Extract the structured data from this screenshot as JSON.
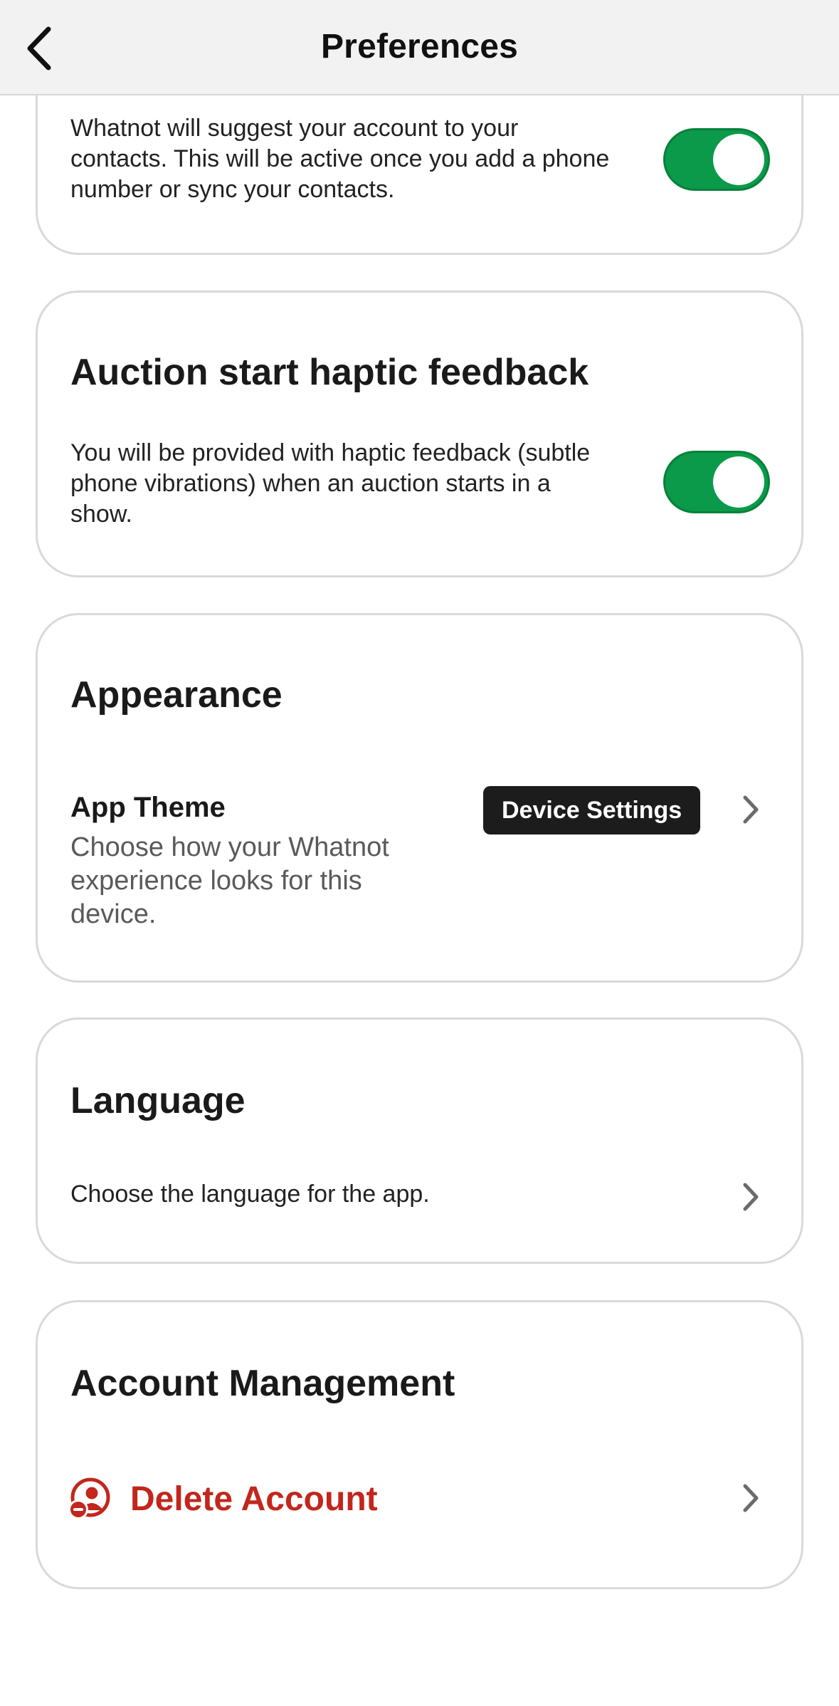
{
  "header": {
    "title": "Preferences"
  },
  "suggest_card": {
    "description": "Whatnot will suggest your account to your contacts. This will be active once you add a phone number or sync your contacts.",
    "toggle_on": true
  },
  "haptic_card": {
    "title": "Auction start haptic feedback",
    "description": "You will be provided with haptic feedback (subtle phone vibrations) when an auction starts in a show.",
    "toggle_on": true
  },
  "appearance_card": {
    "title": "Appearance",
    "app_theme": {
      "label": "App Theme",
      "description": "Choose how your Whatnot experience looks for this device.",
      "value": "Device Settings"
    }
  },
  "language_card": {
    "title": "Language",
    "description": "Choose the language for the app."
  },
  "account_card": {
    "title": "Account Management",
    "delete_label": "Delete Account"
  },
  "colors": {
    "toggle_on": "#0a9a49",
    "danger": "#c2261c",
    "badge_bg": "#1c1c1c"
  },
  "icons": {
    "back": "chevron-left-icon",
    "row": "chevron-right-icon",
    "delete": "user-remove-icon"
  }
}
